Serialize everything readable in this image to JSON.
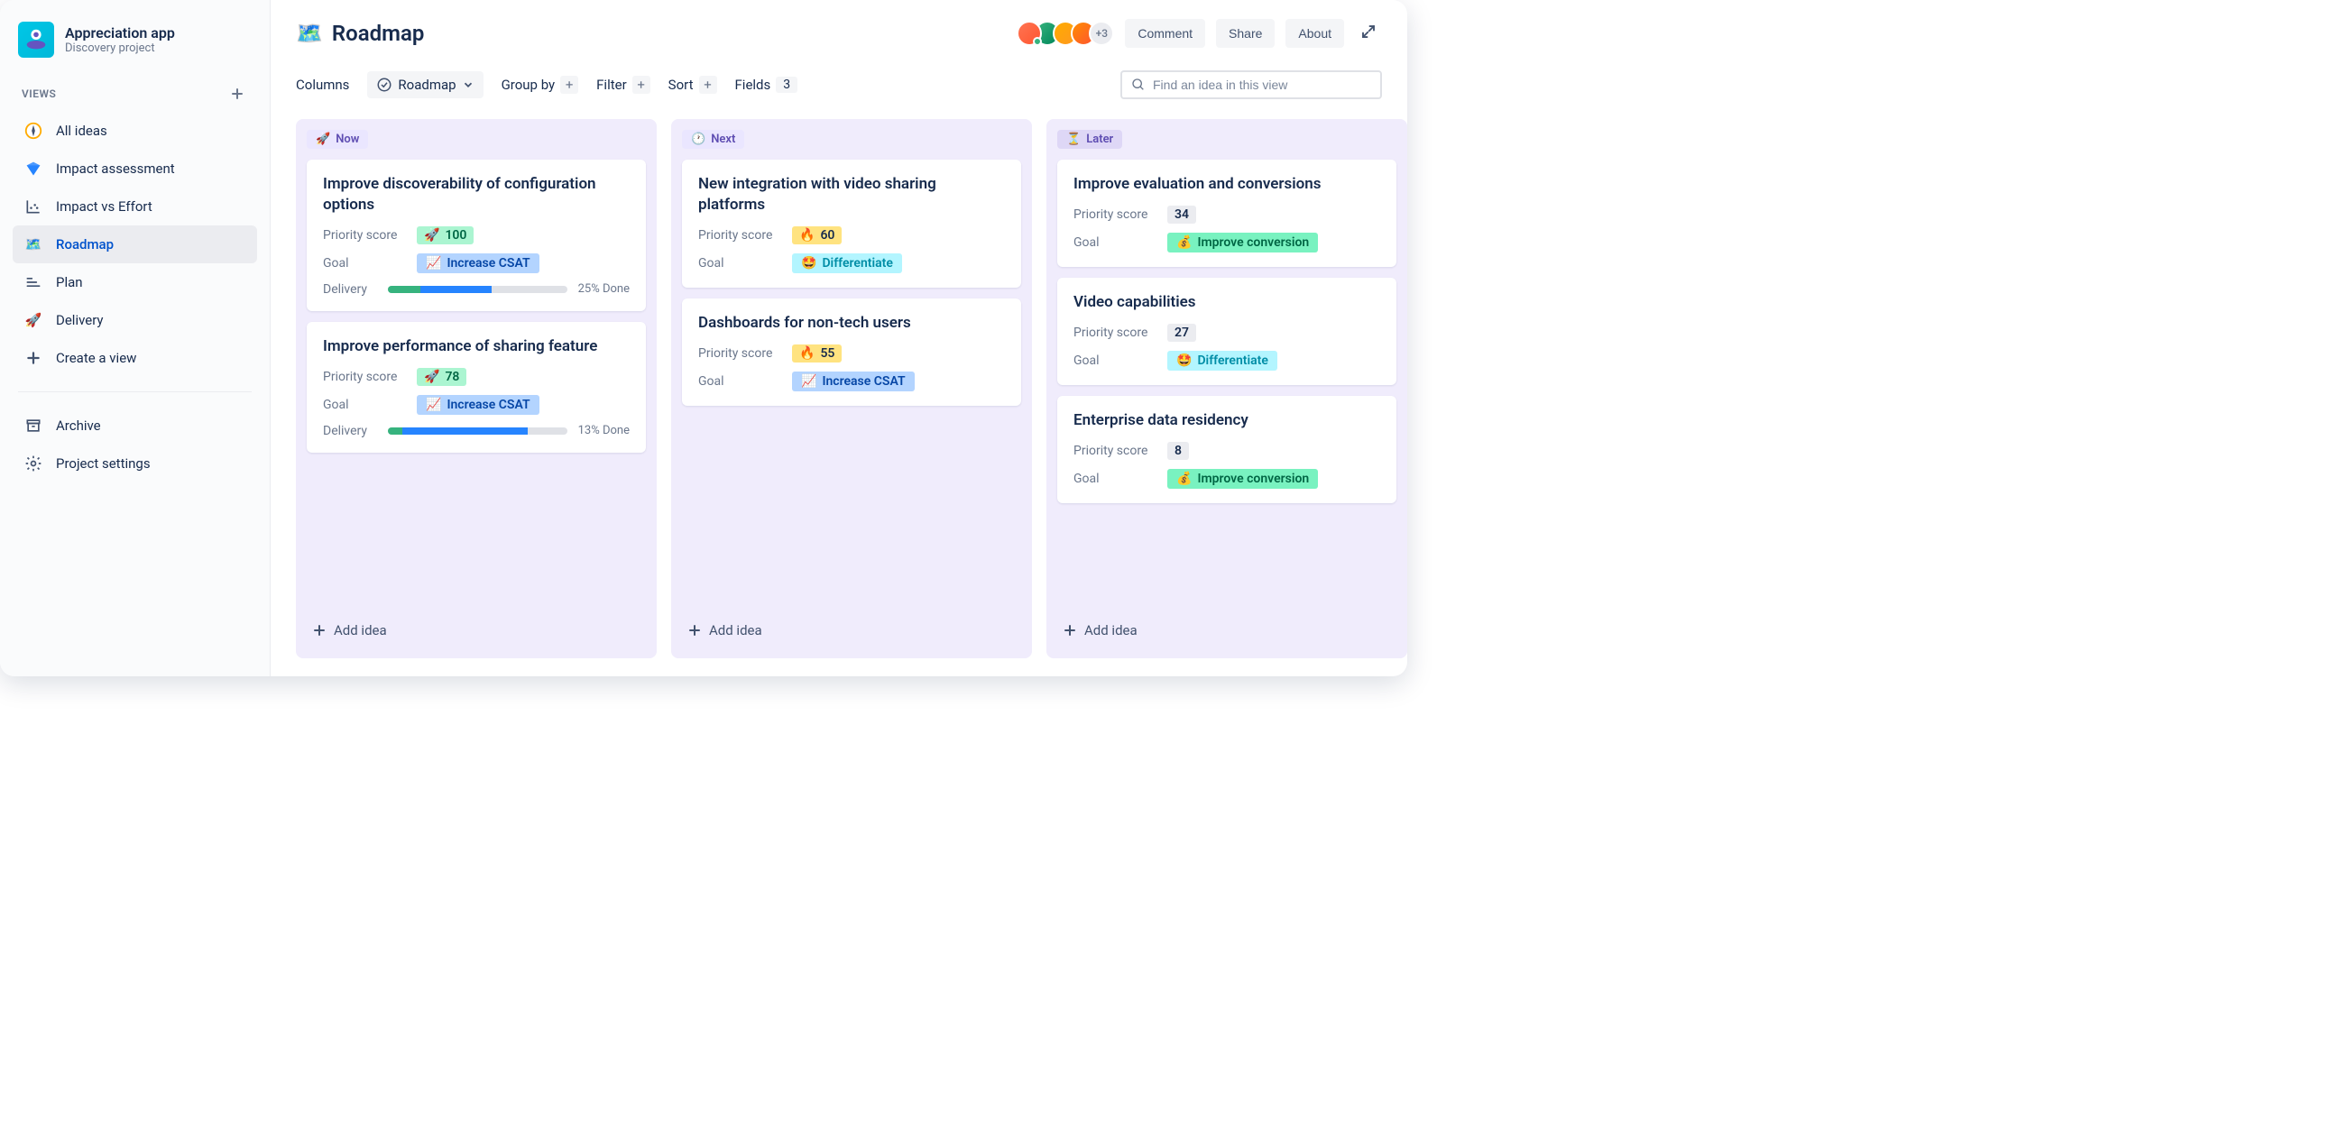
{
  "app": {
    "name": "Appreciation app",
    "subtitle": "Discovery project"
  },
  "views_label": "VIEWS",
  "nav": {
    "all_ideas": "All ideas",
    "impact_assessment": "Impact assessment",
    "impact_vs_effort": "Impact vs Effort",
    "roadmap": "Roadmap",
    "plan": "Plan",
    "delivery": "Delivery",
    "create_view": "Create a view",
    "archive": "Archive",
    "project_settings": "Project settings"
  },
  "header": {
    "page_icon": "🗺️",
    "page_title": "Roadmap",
    "avatar_overflow": "+3",
    "comment": "Comment",
    "share": "Share",
    "about": "About"
  },
  "controls": {
    "columns": "Columns",
    "roadmap": "Roadmap",
    "group_by": "Group by",
    "filter": "Filter",
    "sort": "Sort",
    "fields": "Fields",
    "fields_count": "3",
    "search_placeholder": "Find an idea in this view"
  },
  "labels": {
    "priority_score": "Priority score",
    "goal": "Goal",
    "delivery": "Delivery",
    "add_idea": "Add idea"
  },
  "columns": {
    "now": {
      "icon": "🚀",
      "label": "Now"
    },
    "next": {
      "icon": "🕐",
      "label": "Next"
    },
    "later": {
      "icon": "⏳",
      "label": "Later"
    }
  },
  "cards": {
    "c1": {
      "title": "Improve discoverability of configuration options",
      "score": "100",
      "score_icon": "🚀",
      "goal": "Increase CSAT",
      "goal_icon": "📈",
      "delivery_text": "25% Done",
      "delivery_seg1": 18,
      "delivery_seg2": 40
    },
    "c2": {
      "title": "Improve performance of sharing feature",
      "score": "78",
      "score_icon": "🚀",
      "goal": "Increase CSAT",
      "goal_icon": "📈",
      "delivery_text": "13% Done",
      "delivery_seg1": 8,
      "delivery_seg2": 70
    },
    "c3": {
      "title": "New integration with video sharing platforms",
      "score": "60",
      "score_icon": "🔥",
      "goal": "Differentiate",
      "goal_icon": "🤩"
    },
    "c4": {
      "title": "Dashboards for non-tech users",
      "score": "55",
      "score_icon": "🔥",
      "goal": "Increase CSAT",
      "goal_icon": "📈"
    },
    "c5": {
      "title": "Improve evaluation and conversions",
      "score": "34",
      "goal": "Improve conversion",
      "goal_icon": "💰"
    },
    "c6": {
      "title": "Video capabilities",
      "score": "27",
      "goal": "Differentiate",
      "goal_icon": "🤩"
    },
    "c7": {
      "title": "Enterprise data residency",
      "score": "8",
      "goal": "Improve conversion",
      "goal_icon": "💰"
    }
  }
}
